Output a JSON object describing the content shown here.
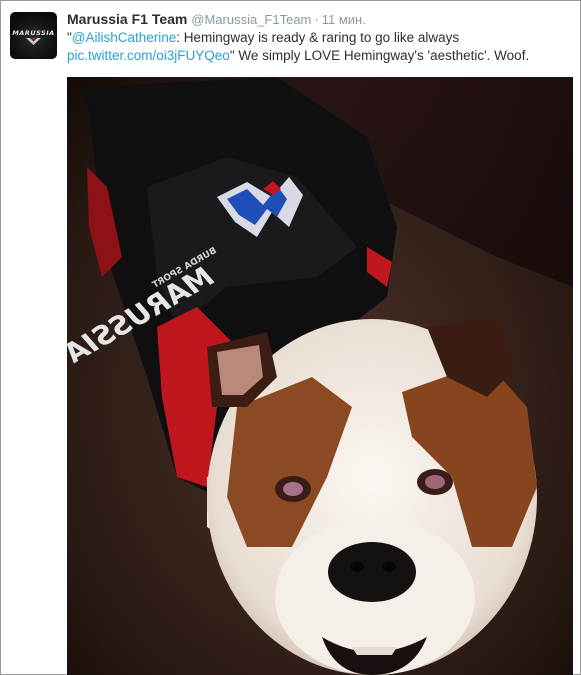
{
  "tweet": {
    "author_name": "Marussia F1 Team",
    "author_handle": "@Marussia_F1Team",
    "separator": "·",
    "timestamp": "11 мин.",
    "text_open_quote": "\"",
    "mention": "@AilishCatherine",
    "text_part1": ": Hemingway is ready & raring to go like always",
    "media_link": "pic.twitter.com/oi3jFUYQeo",
    "text_part2": "\" We simply LOVE Hemingway's 'aesthetic'. Woof."
  },
  "avatar": {
    "logo_text": "MARUSSIA"
  },
  "photo": {
    "jersey_text": "MARUSSIA",
    "jersey_subtext": "BURDA SPORT"
  },
  "colors": {
    "link": "#2b9fd9",
    "name": "#292f33",
    "meta": "#8899a6",
    "jersey_red": "#c0161d"
  }
}
